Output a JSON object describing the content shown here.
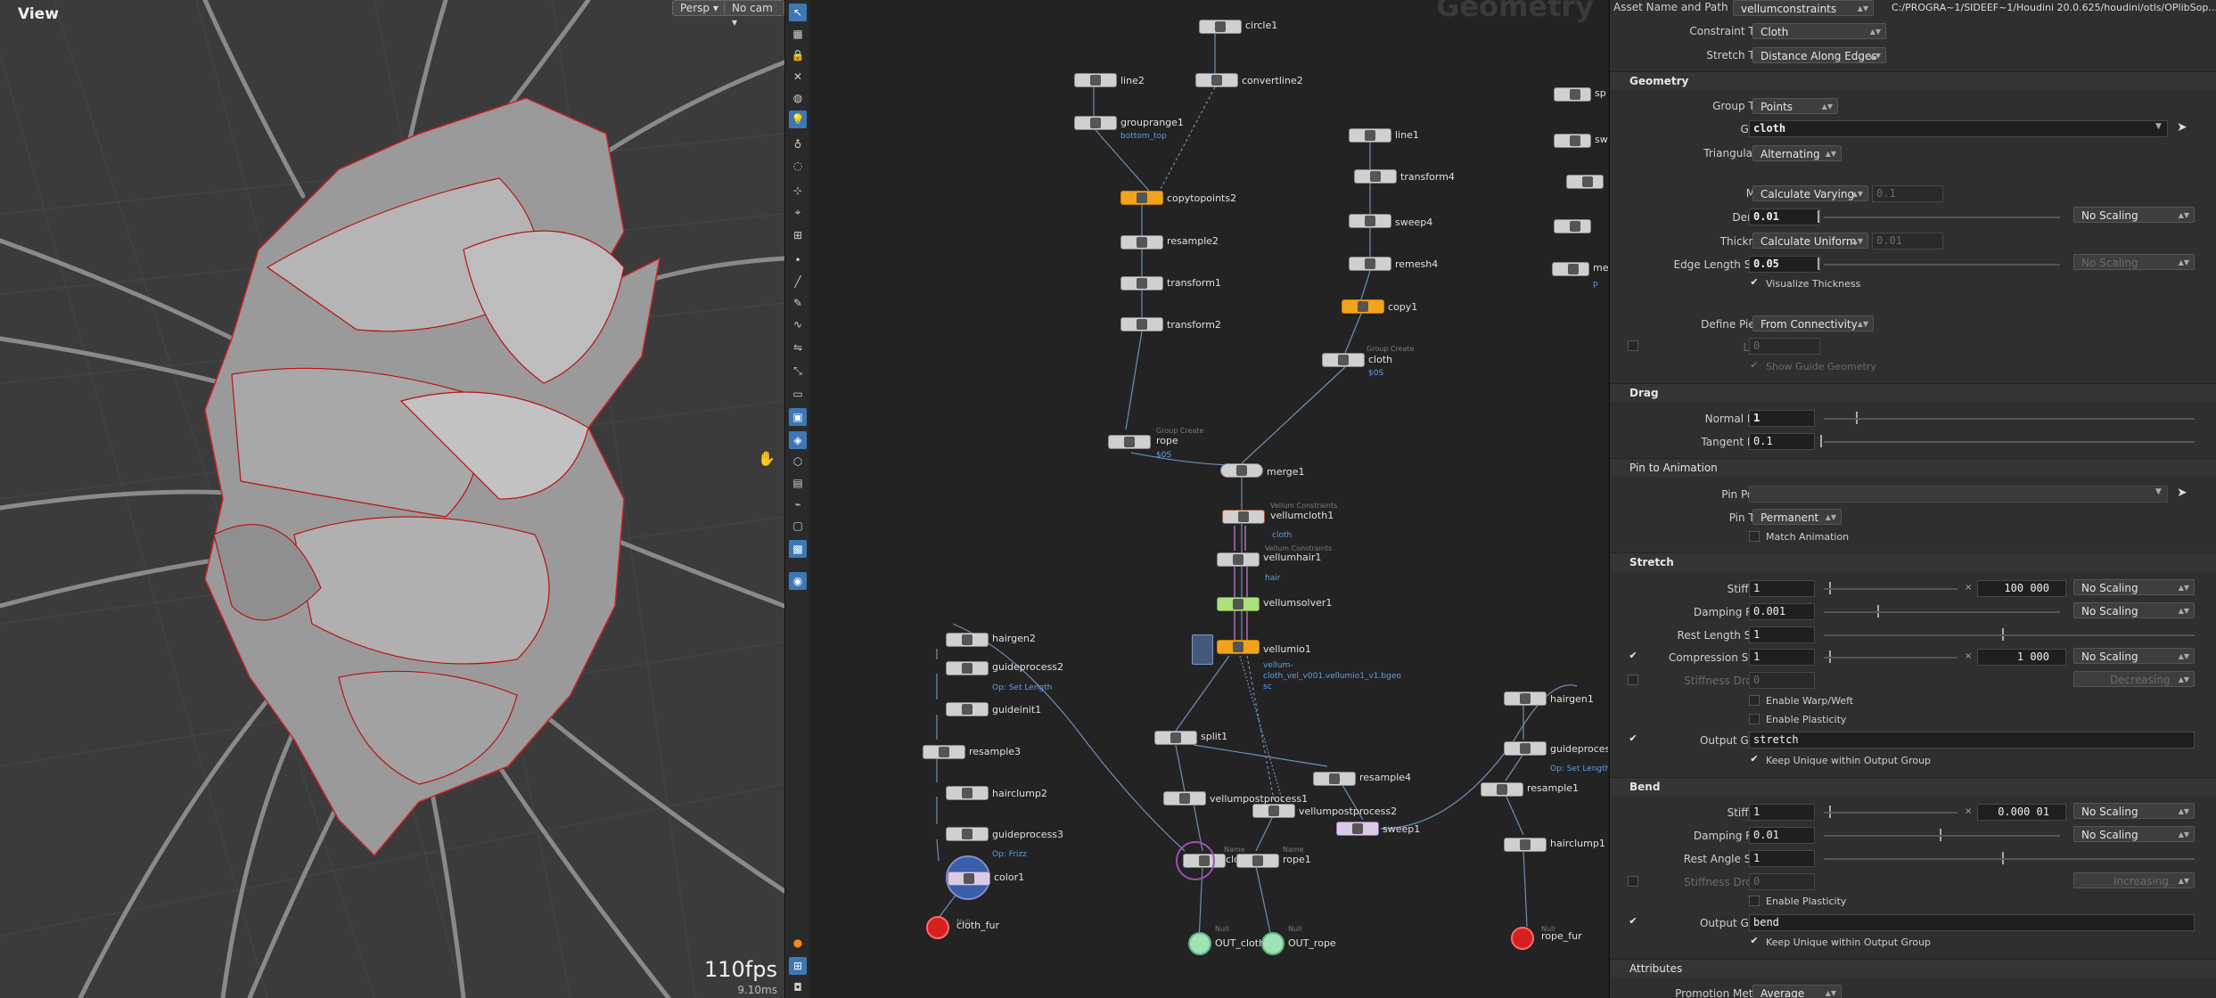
{
  "viewport": {
    "title": "View",
    "view_mode": "Persp",
    "camera": "No cam",
    "fps": "110fps",
    "fps_sub": "9.10ms"
  },
  "network": {
    "context_title": "Geometry",
    "nodes": {
      "circle1": "circle1",
      "line2": "line2",
      "convertline2": "convertline2",
      "grouprange1": "grouprange1",
      "grouprange1_sub": "bottom_top",
      "copytopoints2": "copytopoints2",
      "resample2": "resample2",
      "transform1": "transform1",
      "transform2": "transform2",
      "rope": "rope",
      "rope_type": "Group Create",
      "rope_sub": "$0S",
      "line1": "line1",
      "transform4": "transform4",
      "sweep4": "sweep4",
      "remesh4": "remesh4",
      "copy1": "copy1",
      "cloth": "cloth",
      "cloth_type": "Group Create",
      "cloth_sub": "$0S",
      "merge1": "merge1",
      "vellumcloth1": "vellumcloth1",
      "vellumcloth1_type": "Vellum Constraints",
      "vellumcloth1_sub": "cloth",
      "vellumhair1": "vellumhair1",
      "vellumhair1_type": "Vellum Constraints",
      "vellumhair1_sub": "hair",
      "vellumsolver1": "vellumsolver1",
      "vellumio1": "vellumio1",
      "vellumio1_sub1": "vellum-",
      "vellumio1_sub2": "cloth_vel_v001.vellumio1_v1.bgeo",
      "vellumio1_sub3": "sc",
      "split1": "split1",
      "vellumpostprocess1": "vellumpostprocess1",
      "vellumpostprocess2": "vellumpostprocess2",
      "resample4": "resample4",
      "sweep1": "sweep1",
      "cloth2": "cloth",
      "cloth2_type": "Name",
      "rope1": "rope1",
      "rope1_type": "Name",
      "out_cloth": "OUT_cloth",
      "out_cloth_type": "Null",
      "out_rope": "OUT_rope",
      "out_rope_type": "Null",
      "hairgen2": "hairgen2",
      "guideprocess2": "guideprocess2",
      "guideprocess2_sub": "Op: Set Length",
      "guideinit1": "guideinit1",
      "resample3": "resample3",
      "hairclump2": "hairclump2",
      "guideprocess3": "guideprocess3",
      "guideprocess3_sub": "Op: Frizz",
      "color1": "color1",
      "cloth_fur": "cloth_fur",
      "cloth_fur_type": "Null",
      "hairgen1": "hairgen1",
      "guideprocess1": "guideprocess1",
      "guideprocess1_sub": "Op: Set Length",
      "resample1": "resample1",
      "hairclump1": "hairclump1",
      "rope_fur": "rope_fur",
      "rope_fur_type": "Null",
      "edge1": "sp",
      "edge2": "sw",
      "edge3": "me",
      "edge3_sub": "p"
    }
  },
  "params": {
    "asset_label": "Asset Name and Path",
    "asset_name": "vellumconstraints",
    "asset_path": "C:/PROGRA~1/SIDEEF~1/Houdini 20.0.625/houdini/otls/OPlibSop...",
    "constraint_type_label": "Constraint Type",
    "constraint_type": "Cloth",
    "stretch_type_label": "Stretch Type",
    "stretch_type": "Distance Along Edges",
    "geometry_header": "Geometry",
    "group_type_label": "Group Type",
    "group_type": "Points",
    "group_label": "Group",
    "group_value": "cloth",
    "triangulation_label": "Triangulation",
    "triangulation": "Alternating",
    "mass_label": "Mass",
    "mass": "Calculate Varying",
    "mass_value": "0.1",
    "density_label": "Density",
    "density": "0.01",
    "density_scaling": "No Scaling",
    "thickness_label": "Thickness",
    "thickness": "Calculate Uniform",
    "thickness_value": "0.01",
    "edge_length_scale_label": "Edge Length Scale",
    "edge_length_scale": "0.05",
    "edge_scaling": "No Scaling",
    "visualize_thickness": "Visualize Thickness",
    "define_pieces_label": "Define Pieces",
    "define_pieces": "From Connectivity",
    "layer_label": "Layer",
    "layer_value": "0",
    "show_guide_geometry": "Show Guide Geometry",
    "drag_header": "Drag",
    "normal_drag_label": "Normal Drag",
    "normal_drag": "1",
    "tangent_drag_label": "Tangent Drag",
    "tangent_drag": "0.1",
    "pin_header": "Pin to Animation",
    "pin_points_label": "Pin Points",
    "pin_type_label": "Pin Type",
    "pin_type": "Permanent",
    "match_animation": "Match Animation",
    "stretch_header": "Stretch",
    "s_stiffness_label": "Stiffness",
    "s_stiffness": "1",
    "s_stiffness_mult": "100 000",
    "s_stiffness_scaling": "No Scaling",
    "s_damping_label": "Damping Ratio",
    "s_damping": "0.001",
    "s_damping_scaling": "No Scaling",
    "rest_length_label": "Rest Length Scale",
    "rest_length": "1",
    "compression_label": "Compression Stiff...",
    "compression": "1",
    "compression_mult": "1 000",
    "compression_scaling": "No Scaling",
    "stiffness_dropoff_label": "Stiffness Dropoff",
    "s_dropoff": "0",
    "s_dropoff_mode": "Decreasing",
    "enable_warp_weft": "Enable Warp/Weft",
    "enable_plasticity": "Enable Plasticity",
    "output_group_label": "Output Group",
    "s_output_group": "stretch",
    "keep_unique": "Keep Unique within Output Group",
    "bend_header": "Bend",
    "b_stiffness_label": "Stiffness",
    "b_stiffness": "1",
    "b_stiffness_mult": "0.000 01",
    "b_stiffness_scaling": "No Scaling",
    "b_damping_label": "Damping Ratio",
    "b_damping": "0.01",
    "b_damping_scaling": "No Scaling",
    "rest_angle_label": "Rest Angle Scale",
    "rest_angle": "1",
    "b_dropoff_label": "Stiffness Dropoff",
    "b_dropoff": "0",
    "b_dropoff_mode": "Increasing",
    "b_enable_plasticity": "Enable Plasticity",
    "b_output_group_label": "Output Group",
    "b_output_group": "bend",
    "b_keep_unique": "Keep Unique within Output Group",
    "attributes_header": "Attributes",
    "promotion_label": "Promotion Method",
    "promotion": "Average",
    "multiply_sign": "×"
  }
}
